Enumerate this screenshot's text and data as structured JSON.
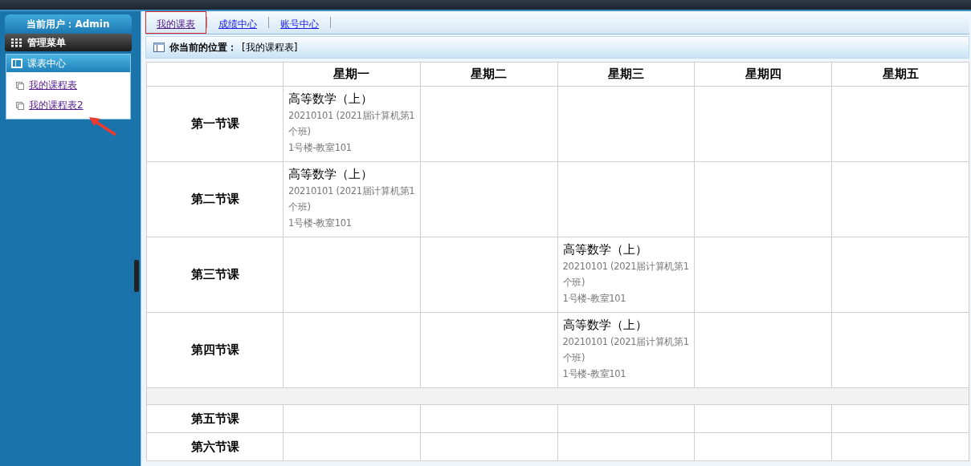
{
  "sidebar": {
    "user_label": "当前用户：Admin",
    "menu_title": "管理菜单",
    "group": {
      "title": "课表中心",
      "items": [
        {
          "label": "我的课程表"
        },
        {
          "label": "我的课程表2"
        }
      ]
    }
  },
  "tabs": [
    {
      "label": "我的课表",
      "selected": true
    },
    {
      "label": "成绩中心",
      "selected": false
    },
    {
      "label": "账号中心",
      "selected": false
    }
  ],
  "breadcrumb": {
    "label": "你当前的位置：",
    "path": "[我的课程表]"
  },
  "timetable": {
    "columns": [
      "星期一",
      "星期二",
      "星期三",
      "星期四",
      "星期五"
    ],
    "rows": [
      {
        "kind": "period",
        "label": "第一节课",
        "cells": [
          {
            "course": "高等数学（上）",
            "class": "20210101 (2021届计算机第1个班)",
            "room": "1号楼-教室101"
          },
          null,
          null,
          null,
          null
        ]
      },
      {
        "kind": "period",
        "label": "第二节课",
        "cells": [
          {
            "course": "高等数学（上）",
            "class": "20210101 (2021届计算机第1个班)",
            "room": "1号楼-教室101"
          },
          null,
          null,
          null,
          null
        ]
      },
      {
        "kind": "period",
        "label": "第三节课",
        "cells": [
          null,
          null,
          {
            "course": "高等数学（上）",
            "class": "20210101 (2021届计算机第1个班)",
            "room": "1号楼-教室101"
          },
          null,
          null
        ]
      },
      {
        "kind": "period",
        "label": "第四节课",
        "cells": [
          null,
          null,
          {
            "course": "高等数学（上）",
            "class": "20210101 (2021届计算机第1个班)",
            "room": "1号楼-教室101"
          },
          null,
          null
        ]
      },
      {
        "kind": "break"
      },
      {
        "kind": "short",
        "label": "第五节课",
        "cells": [
          null,
          null,
          null,
          null,
          null
        ]
      },
      {
        "kind": "short",
        "label": "第六节课",
        "cells": [
          null,
          null,
          null,
          null,
          null
        ]
      }
    ]
  }
}
